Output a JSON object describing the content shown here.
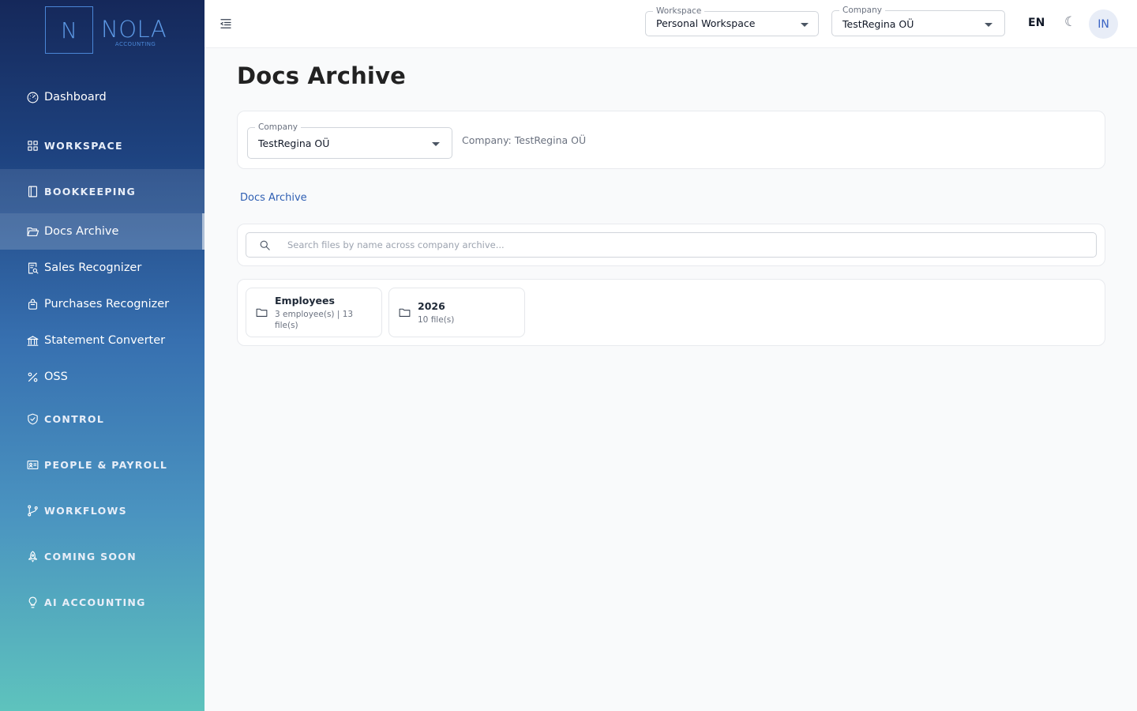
{
  "brand": {
    "mark": "N",
    "name": "NOLA",
    "tagline": "ACCOUNTING"
  },
  "sidebar": {
    "items": [
      {
        "label": "Dashboard",
        "icon": "gauge-icon"
      },
      {
        "label": "WORKSPACE",
        "icon": "grid-icon"
      },
      {
        "label": "BOOKKEEPING",
        "icon": "book-icon"
      },
      {
        "label": "Docs Archive",
        "icon": "folder-open-icon",
        "active": true
      },
      {
        "label": "Sales Recognizer",
        "icon": "receipt-search-icon"
      },
      {
        "label": "Purchases Recognizer",
        "icon": "bag-icon"
      },
      {
        "label": "Statement Converter",
        "icon": "bank-icon"
      },
      {
        "label": "OSS",
        "icon": "percent-icon"
      },
      {
        "label": "CONTROL",
        "icon": "shield-check-icon"
      },
      {
        "label": "PEOPLE & PAYROLL",
        "icon": "id-card-icon"
      },
      {
        "label": "WORKFLOWS",
        "icon": "branch-icon"
      },
      {
        "label": "COMING SOON",
        "icon": "rocket-icon"
      },
      {
        "label": "AI ACCOUNTING",
        "icon": "lightbulb-icon"
      }
    ]
  },
  "topbar": {
    "workspace": {
      "label": "Workspace",
      "value": "Personal Workspace"
    },
    "company": {
      "label": "Company",
      "value": "TestRegina OÜ"
    },
    "language": "EN",
    "theme_glyph": "☾",
    "avatar_initials": "IN"
  },
  "main": {
    "title": "Docs Archive",
    "company_filter": {
      "label": "Company",
      "value": "TestRegina OÜ"
    },
    "company_info": "Company: TestRegina OÜ",
    "breadcrumb": "Docs Archive",
    "search": {
      "placeholder": "Search files by name across company archive..."
    },
    "folders": [
      {
        "name": "Employees",
        "meta": "3 employee(s) | 13 file(s)"
      },
      {
        "name": "2026",
        "meta": "10 file(s)"
      }
    ]
  },
  "colors": {
    "accent": "#2f5fb3",
    "sidebar_top": "#15285a",
    "sidebar_bottom": "#5ec3bd"
  }
}
